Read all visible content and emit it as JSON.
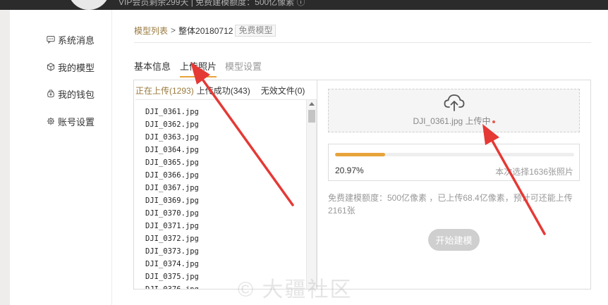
{
  "banner": {
    "text": "VIP会员剩余299天 | 免费建模额度：500亿像素 ⓘ"
  },
  "sidebar": {
    "items": [
      {
        "label": "系统消息",
        "icon": "message-icon"
      },
      {
        "label": "我的模型",
        "icon": "cube-icon"
      },
      {
        "label": "我的钱包",
        "icon": "wallet-icon"
      },
      {
        "label": "账号设置",
        "icon": "gear-icon"
      }
    ]
  },
  "breadcrumb": {
    "root": "模型列表",
    "separator": ">",
    "current": "整体20180712",
    "badge": "免费模型"
  },
  "tabs": [
    {
      "label": "基本信息",
      "active": false
    },
    {
      "label": "上传照片",
      "active": true
    },
    {
      "label": "模型设置",
      "active": false
    }
  ],
  "filters": {
    "uploading": "正在上传(1293)",
    "success": "上传成功(343)",
    "invalid": "无效文件(0)"
  },
  "files": [
    "DJI_0361.jpg",
    "DJI_0362.jpg",
    "DJI_0363.jpg",
    "DJI_0364.jpg",
    "DJI_0365.jpg",
    "DJI_0366.jpg",
    "DJI_0367.jpg",
    "DJI_0369.jpg",
    "DJI_0370.jpg",
    "DJI_0371.jpg",
    "DJI_0372.jpg",
    "DJI_0373.jpg",
    "DJI_0374.jpg",
    "DJI_0375.jpg",
    "DJI_0376.jpg"
  ],
  "upload": {
    "status": "DJI_0361.jpg 上传中"
  },
  "progress": {
    "percent_label": "20.97%",
    "fraction": 0.2097,
    "count_text": "本次选择1636张照片"
  },
  "quota_note": "免费建模额度：500亿像素 ，已上传68.4亿像素，预计可还能上传2161张",
  "start_button": "开始建模",
  "watermark": "© 大疆社区",
  "colors": {
    "accent": "#e8a33a",
    "link": "#9a7a3e",
    "annotation_arrow": "#e53935",
    "button_disabled": "#cfcfcf"
  }
}
